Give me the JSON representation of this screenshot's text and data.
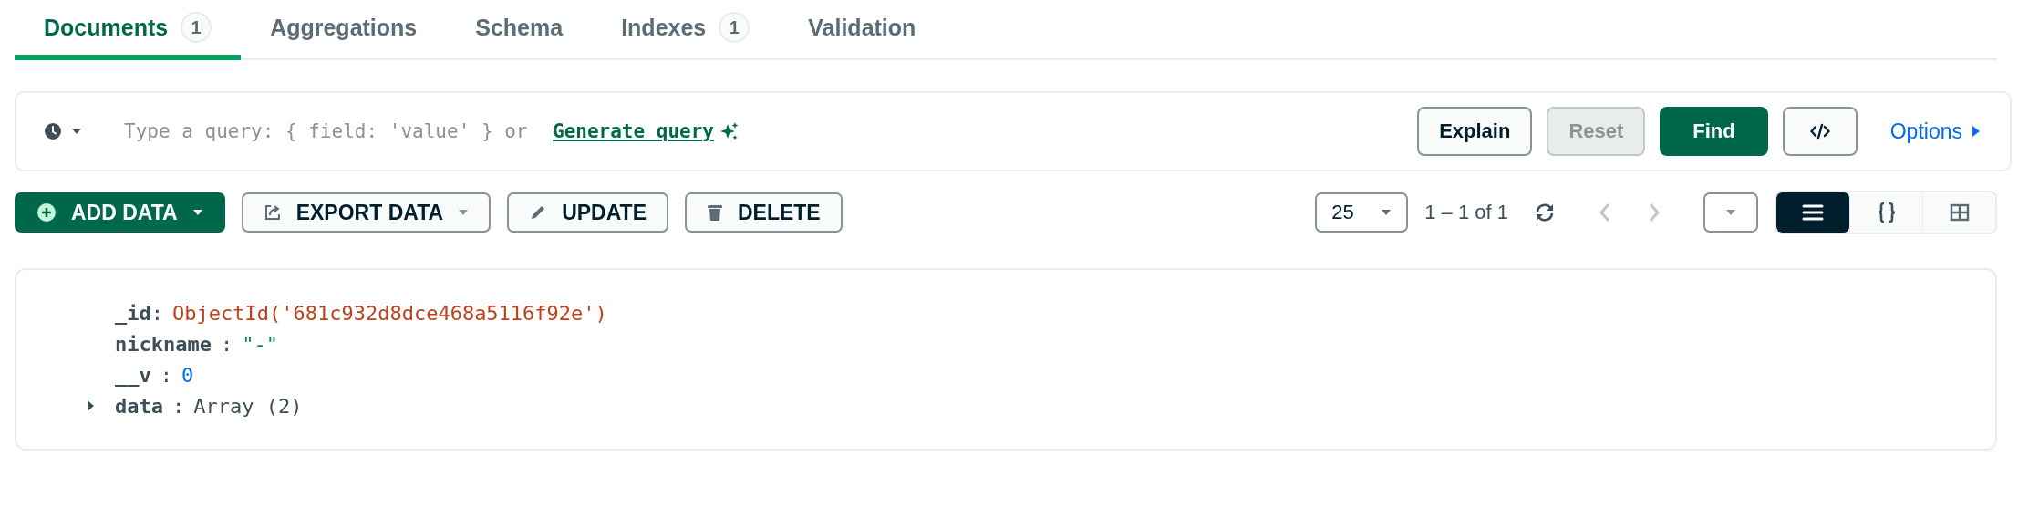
{
  "tabs": [
    {
      "label": "Documents",
      "count": "1",
      "selected": true
    },
    {
      "label": "Aggregations",
      "selected": false
    },
    {
      "label": "Schema",
      "selected": false
    },
    {
      "label": "Indexes",
      "count": "1",
      "selected": false
    },
    {
      "label": "Validation",
      "selected": false
    }
  ],
  "query_bar": {
    "placeholder": "Type a query: { field: 'value' } or",
    "generate_link": "Generate query",
    "buttons": [
      {
        "label": "Explain",
        "kind": "default",
        "disabled": false
      },
      {
        "label": "Reset",
        "kind": "default",
        "disabled": true
      },
      {
        "label": "Find",
        "kind": "primary",
        "disabled": false
      }
    ],
    "options_label": "Options"
  },
  "actions": [
    {
      "label": "ADD DATA",
      "kind": "primary",
      "dropdown": true
    },
    {
      "label": "EXPORT DATA",
      "kind": "default",
      "dropdown": true
    },
    {
      "label": "UPDATE",
      "kind": "default",
      "dropdown": false
    },
    {
      "label": "DELETE",
      "kind": "default",
      "dropdown": false
    }
  ],
  "pagination": {
    "page_size": "25",
    "range": "1 – 1 of 1",
    "previous_disabled": true,
    "next_disabled": true
  },
  "view_modes": [
    {
      "kind": "list",
      "selected": true
    },
    {
      "kind": "json",
      "selected": false
    },
    {
      "kind": "table",
      "selected": false
    }
  ],
  "document": {
    "fields": [
      {
        "key": "_id",
        "separator": ":",
        "value": "ObjectId('681c932d8dce468a5116f92e')",
        "kind": "objectid"
      },
      {
        "key": "nickname",
        "separator": ":",
        "value": "\"-\"",
        "kind": "string"
      },
      {
        "key": "__v",
        "separator": ":",
        "value": "0",
        "kind": "number"
      },
      {
        "key": "data",
        "separator": ":",
        "value": "Array (2)",
        "kind": "array",
        "expanded": false
      }
    ]
  }
}
